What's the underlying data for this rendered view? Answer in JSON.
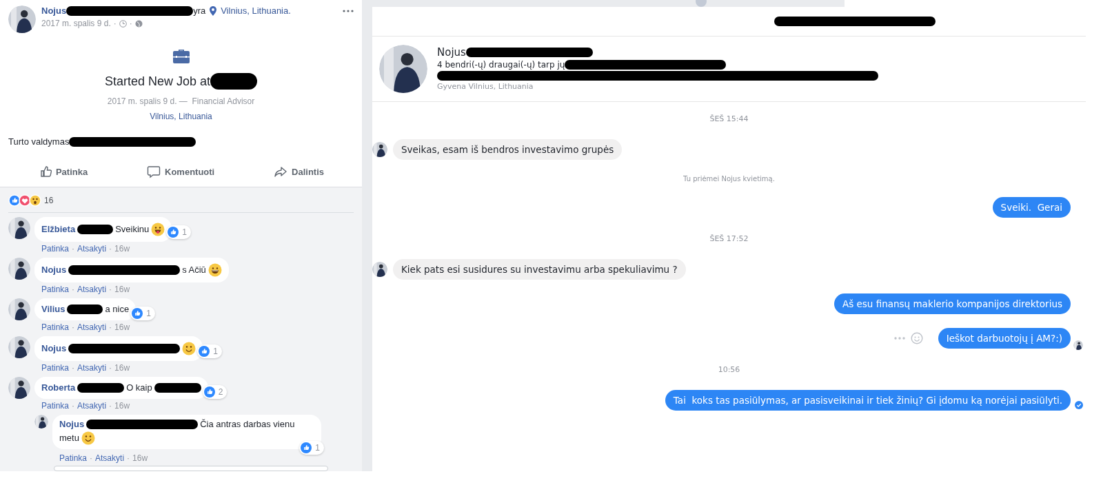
{
  "post": {
    "header_parts": [
      {
        "kind": "name",
        "text": "Nojus"
      },
      {
        "kind": "wideblot"
      },
      {
        "kind": "text",
        "text": "yra"
      },
      {
        "kind": "pin"
      },
      {
        "kind": "place",
        "text": "Vilnius, Lithuania."
      }
    ],
    "meta_parts": [
      {
        "kind": "time",
        "text": "2017 m. spalis 9 d."
      },
      {
        "kind": "sep",
        "text": "·"
      },
      {
        "kind": "clock"
      },
      {
        "kind": "sep",
        "text": "·"
      },
      {
        "kind": "globe"
      }
    ],
    "event": {
      "title_parts": [
        {
          "kind": "text",
          "text": "Started New Job at"
        },
        {
          "kind": "shortblot"
        }
      ],
      "details": "2017 m. spalis 9 d. —  Financial Advisor",
      "place": "Vilnius, Lithuania"
    },
    "body_parts": [
      {
        "kind": "text",
        "text": "Turto valdymas"
      },
      {
        "kind": "wideblot"
      }
    ],
    "actions": [
      {
        "kind": "like",
        "label": "Patinka"
      },
      {
        "kind": "comment",
        "label": "Komentuoti"
      },
      {
        "kind": "share",
        "label": "Dalintis"
      }
    ],
    "reactions": [
      {
        "kind": "like"
      },
      {
        "kind": "love"
      },
      {
        "kind": "wow"
      }
    ],
    "reaction_count": "16"
  },
  "comments": [
    {
      "parts": [
        {
          "kind": "name",
          "text": "Elžbieta"
        },
        {
          "kind": "tinyblot"
        },
        {
          "kind": "text",
          "text": "Sveikinu"
        },
        {
          "kind": "tongue"
        }
      ],
      "likes": "1",
      "meta": [
        {
          "kind": "link",
          "text": "Patinka"
        },
        {
          "kind": "sep",
          "text": "·"
        },
        {
          "kind": "link",
          "text": "Atsakyti"
        },
        {
          "kind": "sep",
          "text": "·"
        },
        {
          "kind": "time",
          "text": "16w"
        }
      ]
    },
    {
      "parts": [
        {
          "kind": "name",
          "text": "Nojus"
        },
        {
          "kind": "longblot"
        },
        {
          "kind": "text",
          "text": "s Ačiū"
        },
        {
          "kind": "grin"
        }
      ],
      "meta": [
        {
          "kind": "link",
          "text": "Patinka"
        },
        {
          "kind": "sep",
          "text": "·"
        },
        {
          "kind": "link",
          "text": "Atsakyti"
        },
        {
          "kind": "sep",
          "text": "·"
        },
        {
          "kind": "time",
          "text": "16w"
        }
      ]
    },
    {
      "parts": [
        {
          "kind": "name",
          "text": "Vilius"
        },
        {
          "kind": "tinyblot"
        },
        {
          "kind": "text",
          "text": "a nice"
        }
      ],
      "likes": "1",
      "meta": [
        {
          "kind": "link",
          "text": "Patinka"
        },
        {
          "kind": "sep",
          "text": "·"
        },
        {
          "kind": "link",
          "text": "Atsakyti"
        },
        {
          "kind": "sep",
          "text": "·"
        },
        {
          "kind": "time",
          "text": "16w"
        }
      ]
    },
    {
      "parts": [
        {
          "kind": "name",
          "text": "Nojus"
        },
        {
          "kind": "longblot"
        },
        {
          "kind": "smile"
        }
      ],
      "likes": "1",
      "meta": [
        {
          "kind": "link",
          "text": "Patinka"
        },
        {
          "kind": "sep",
          "text": "·"
        },
        {
          "kind": "link",
          "text": "Atsakyti"
        },
        {
          "kind": "sep",
          "text": "·"
        },
        {
          "kind": "time",
          "text": "16w"
        }
      ]
    },
    {
      "parts": [
        {
          "kind": "name",
          "text": "Roberta"
        },
        {
          "kind": "shortblot"
        },
        {
          "kind": "text",
          "text": "O kaip"
        },
        {
          "kind": "shortblot"
        }
      ],
      "likes": "2",
      "meta": [
        {
          "kind": "link",
          "text": "Patinka"
        },
        {
          "kind": "sep",
          "text": "·"
        },
        {
          "kind": "link",
          "text": "Atsakyti"
        },
        {
          "kind": "sep",
          "text": "·"
        },
        {
          "kind": "time",
          "text": "16w"
        }
      ],
      "replies": [
        {
          "parts": [
            {
              "kind": "name",
              "text": "Nojus"
            },
            {
              "kind": "longblot"
            },
            {
              "kind": "text",
              "text": "Čia antras darbas vienu"
            },
            {
              "kind": "text",
              "text": "metu"
            },
            {
              "kind": "smile"
            }
          ],
          "likes": "1",
          "meta": [
            {
              "kind": "link",
              "text": "Patinka"
            },
            {
              "kind": "sep",
              "text": "·"
            },
            {
              "kind": "link",
              "text": "Atsakyti"
            },
            {
              "kind": "sep",
              "text": "·"
            },
            {
              "kind": "time",
              "text": "16w"
            }
          ]
        }
      ]
    }
  ],
  "chat": {
    "header_parts": [
      {
        "kind": "xwideblot"
      }
    ],
    "profile": {
      "name_parts": [
        {
          "kind": "text",
          "text": "Nojus"
        },
        {
          "kind": "wideblot"
        }
      ],
      "mutual_parts": [
        {
          "kind": "text",
          "text": "4 bendri(-ų) draugai(-ų) tarp jų"
        },
        {
          "kind": "xwideblot"
        }
      ],
      "info_parts": [
        {
          "kind": "hugeblot"
        }
      ],
      "lives": "Gyvena Vilnius, Lithuania"
    },
    "messages": [
      {
        "kind": "time",
        "text": "ŠEŠ 15:44"
      },
      {
        "kind": "incoming",
        "text": "Sveikas, esam iš bendros investavimo grupės"
      },
      {
        "kind": "notice",
        "text": "Tu priėmei Nojus kvietimą."
      },
      {
        "kind": "outgoing",
        "text": "Sveiki.  Gerai"
      },
      {
        "kind": "time",
        "text": "ŠEŠ 17:52"
      },
      {
        "kind": "incoming",
        "text": "Kiek pats esi susidures su investavimu arba spekuliavimu ?"
      },
      {
        "kind": "outgoing",
        "text": "Aš esu finansų maklerio kompanijos direktorius"
      },
      {
        "kind": "outgoing",
        "text": "Ieškot darbuotojų į AM?:)",
        "hover_actions": true,
        "seen": true
      },
      {
        "kind": "time",
        "text": "10:56"
      },
      {
        "kind": "outgoing",
        "text": "Tai  koks tas pasiūlymas, ar pasisveikinai ir tiek žinių? Gi įdomu ką norėjai pasiūlyti.",
        "delivered": true
      }
    ]
  }
}
